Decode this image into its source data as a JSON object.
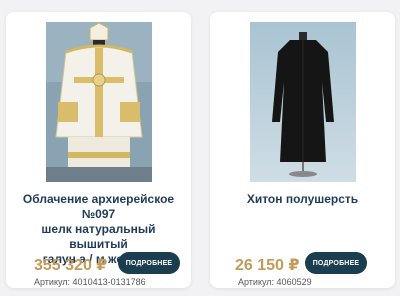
{
  "products": [
    {
      "title_line1": "Облачение архиерейское №097",
      "title_line2": "шелк натуральный вышитый",
      "title_line3": "галун а / м желтый",
      "price": "355 320 ₽",
      "button_label": "ПОДРОБНЕЕ",
      "sku": "Артикул: 4010413-0131786",
      "image": "bishop-vestment-photo"
    },
    {
      "title_line1": "Хитон полушерсть",
      "price": "26 150 ₽",
      "button_label": "ПОДРОБНЕЕ",
      "sku": "Артикул: 4060529",
      "image": "black-cassock-photo"
    }
  ],
  "colors": {
    "title": "#1f3b5b",
    "price": "#c49a5a",
    "button": "#1a3d4f",
    "background": "#f2f2f4"
  }
}
